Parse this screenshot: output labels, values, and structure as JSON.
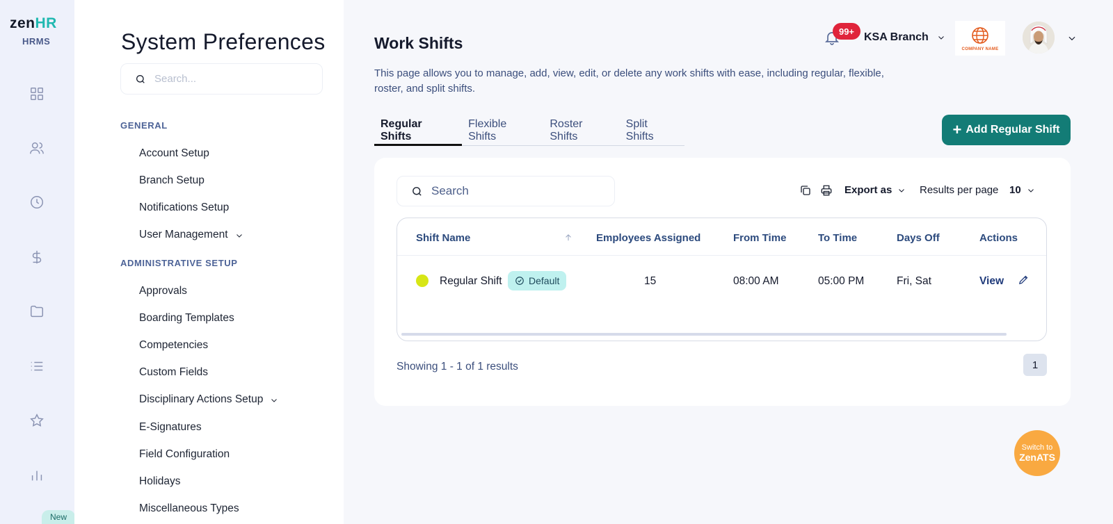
{
  "app": {
    "logo_main": "zen",
    "logo_accent": "HR",
    "logo_sub": "HRMS",
    "new_badge": "New"
  },
  "rail_icons": [
    "dashboard-icon",
    "users-icon",
    "clock-icon",
    "dollar-icon",
    "folder-icon",
    "list-icon",
    "star-icon",
    "bar-chart-icon"
  ],
  "preferences": {
    "title": "System Preferences",
    "search_placeholder": "Search...",
    "sections": [
      {
        "label": "GENERAL",
        "items": [
          {
            "label": "Account Setup",
            "has_chevron": false
          },
          {
            "label": "Branch Setup",
            "has_chevron": false
          },
          {
            "label": "Notifications Setup",
            "has_chevron": false
          },
          {
            "label": "User Management",
            "has_chevron": true
          }
        ]
      },
      {
        "label": "ADMINISTRATIVE SETUP",
        "items": [
          {
            "label": "Approvals",
            "has_chevron": false
          },
          {
            "label": "Boarding Templates",
            "has_chevron": false
          },
          {
            "label": "Competencies",
            "has_chevron": false
          },
          {
            "label": "Custom Fields",
            "has_chevron": false
          },
          {
            "label": "Disciplinary Actions Setup",
            "has_chevron": true
          },
          {
            "label": "E-Signatures",
            "has_chevron": false
          },
          {
            "label": "Field Configuration",
            "has_chevron": false
          },
          {
            "label": "Holidays",
            "has_chevron": false
          },
          {
            "label": "Miscellaneous Types",
            "has_chevron": false
          }
        ]
      }
    ]
  },
  "header": {
    "notification_count": "99+",
    "branch": "KSA Branch",
    "company_logo_text": "COMPANY NAME"
  },
  "page": {
    "title": "Work Shifts",
    "description": "This page allows you to manage, add, view, edit, or delete any work shifts with ease, including regular, flexible, roster, and split shifts.",
    "tabs": [
      {
        "label": "Regular Shifts",
        "active": true
      },
      {
        "label": "Flexible Shifts",
        "active": false
      },
      {
        "label": "Roster Shifts",
        "active": false
      },
      {
        "label": "Split Shifts",
        "active": false
      }
    ],
    "add_button": "Add Regular Shift"
  },
  "table": {
    "search_placeholder": "Search",
    "export_label": "Export as",
    "results_per_page_label": "Results per page",
    "results_per_page_value": "10",
    "columns": [
      "Shift Name",
      "Employees Assigned",
      "From Time",
      "To Time",
      "Days Off",
      "Actions"
    ],
    "rows": [
      {
        "shift_name": "Regular Shift",
        "badge": "Default",
        "color": "#d7e616",
        "employees_assigned": "15",
        "from_time": "08:00 AM",
        "to_time": "05:00 PM",
        "days_off": "Fri, Sat",
        "action_view": "View"
      }
    ],
    "showing": "Showing 1 - 1 of 1 results",
    "current_page": "1"
  },
  "switch": {
    "line1": "Switch to",
    "line2": "ZenATS"
  },
  "colors": {
    "accent": "#137c76",
    "badge_red": "#e0243b",
    "switch_orange": "#f9a941"
  }
}
